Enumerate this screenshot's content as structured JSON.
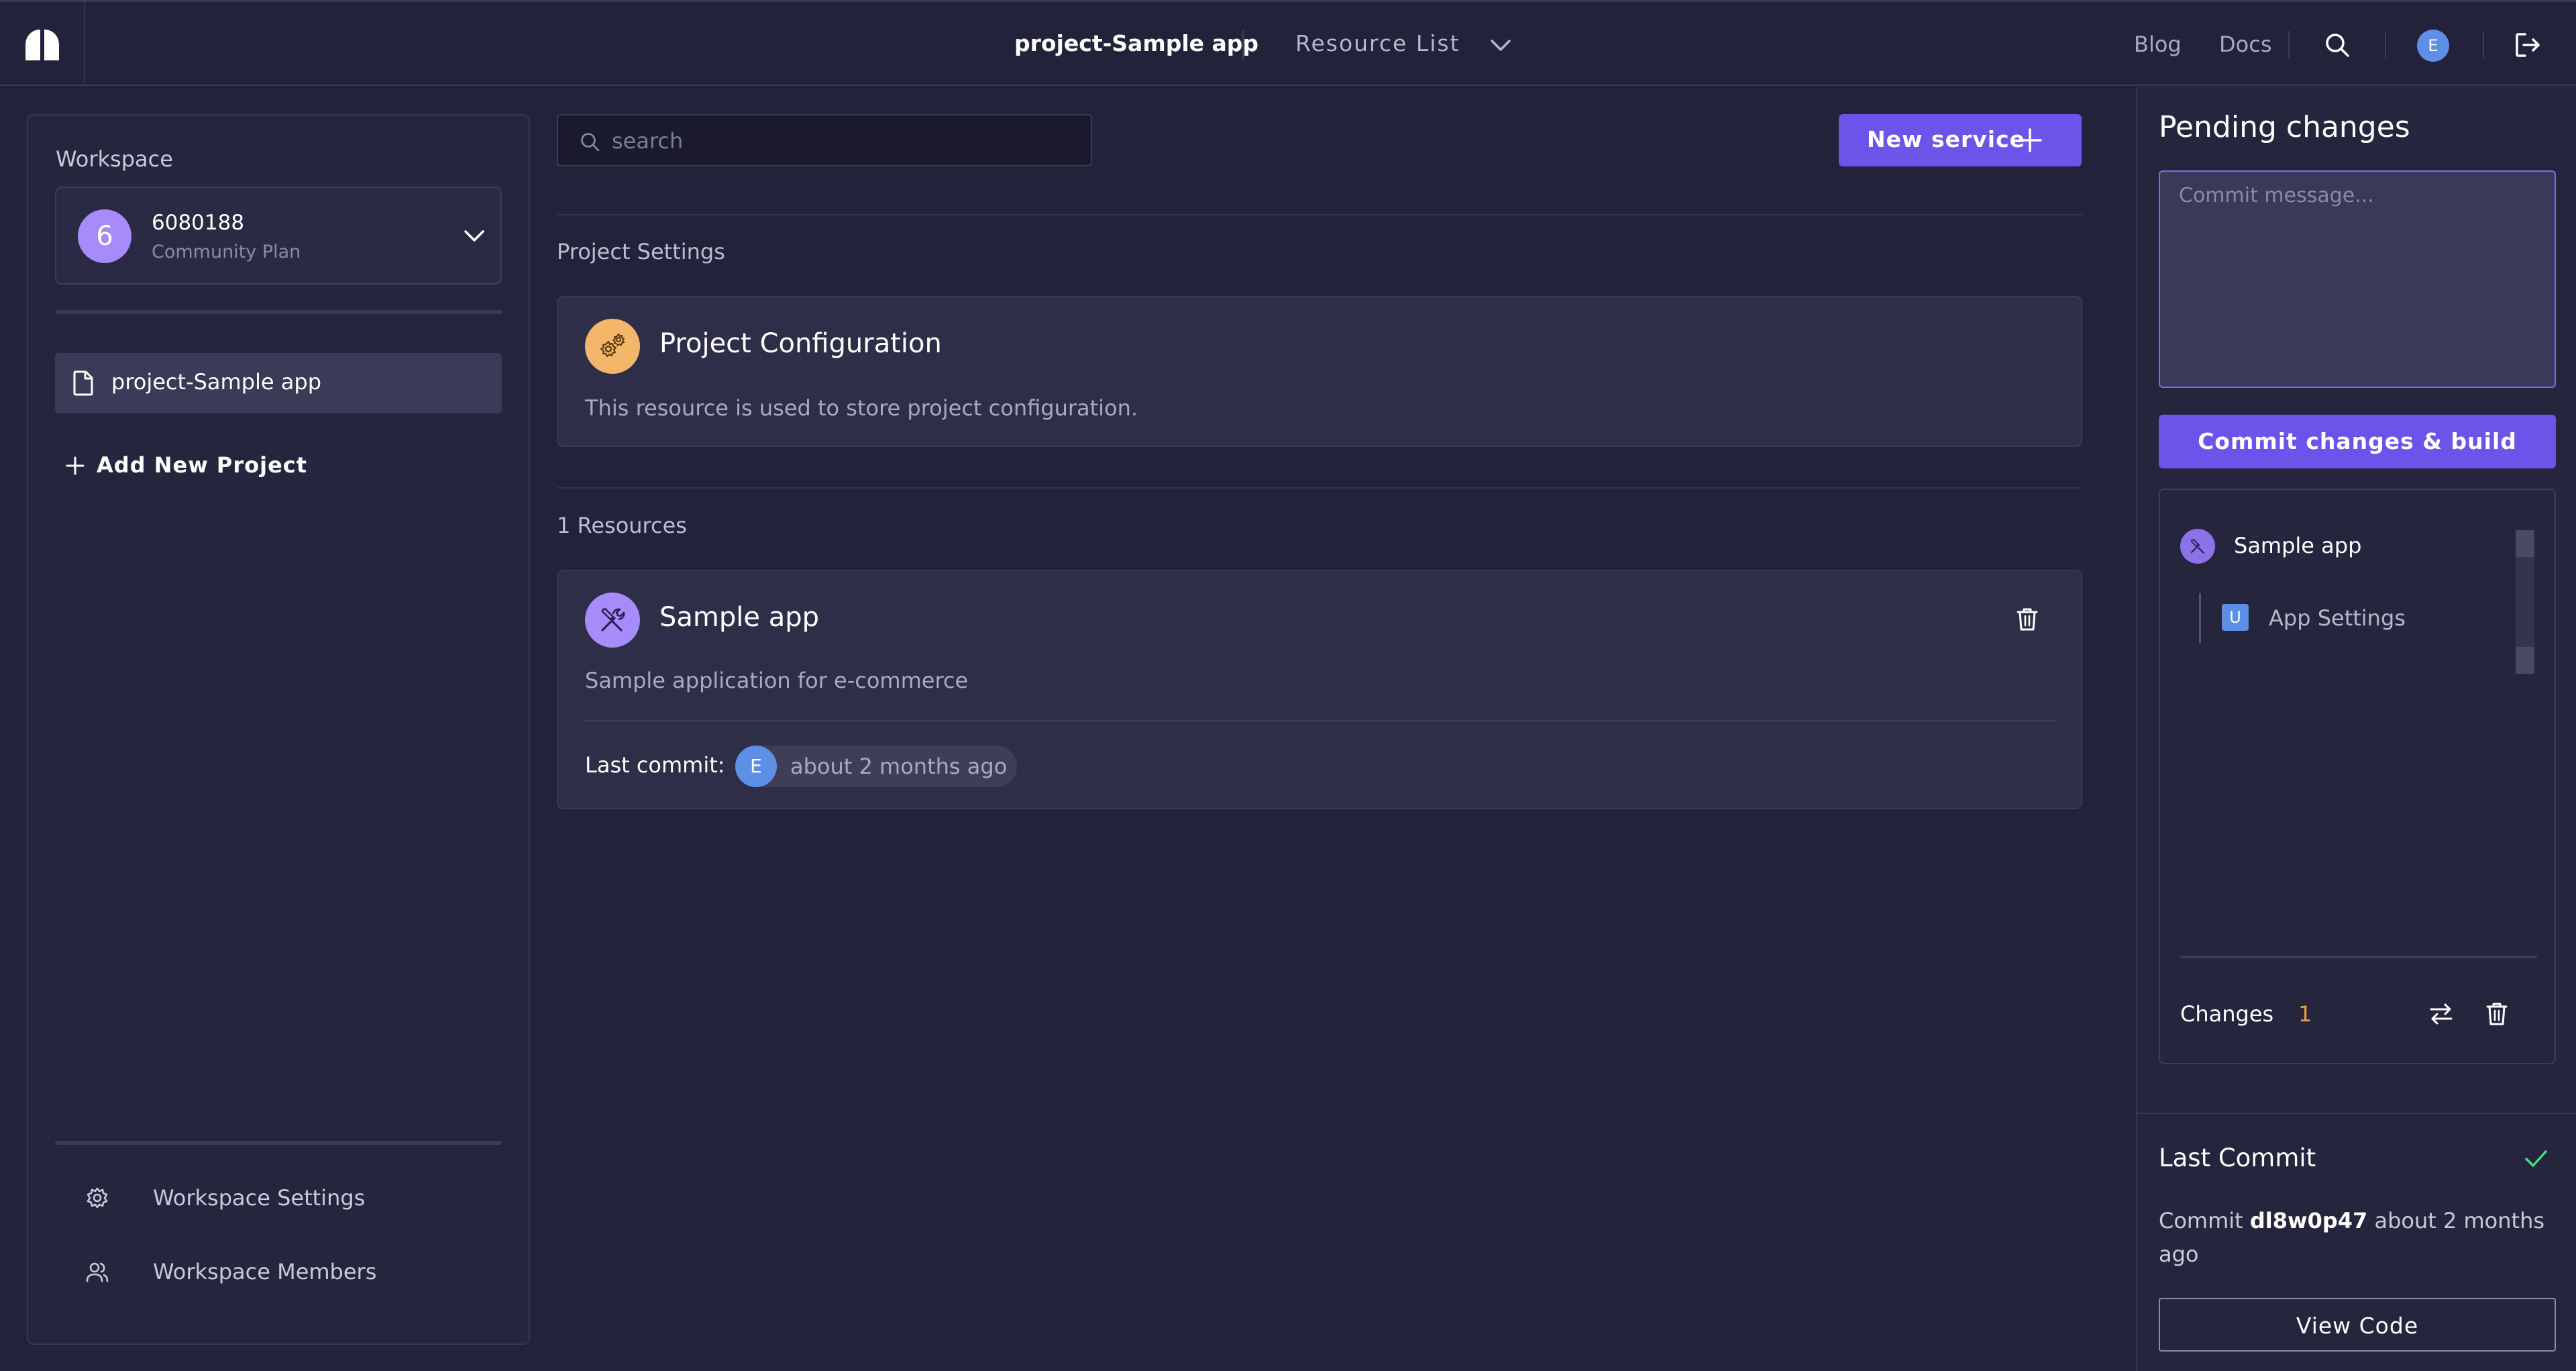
{
  "header": {
    "project_name": "project-Sample app",
    "view_selector": "Resource List",
    "links": {
      "blog": "Blog",
      "docs": "Docs"
    },
    "user_initial": "E"
  },
  "sidebar": {
    "workspace_label": "Workspace",
    "workspace": {
      "initial": "6",
      "name": "6080188",
      "plan": "Community Plan"
    },
    "projects": [
      {
        "label": "project-Sample app",
        "active": true
      }
    ],
    "add_project_label": "Add New Project",
    "footer_links": [
      {
        "label": "Workspace Settings",
        "icon": "gear-icon"
      },
      {
        "label": "Workspace Members",
        "icon": "users-icon"
      }
    ]
  },
  "main": {
    "search": {
      "placeholder": "search",
      "value": ""
    },
    "new_service_label": "New service",
    "project_settings": {
      "section_label": "Project Settings",
      "card": {
        "title": "Project Configuration",
        "description": "This resource is used to store project configuration.",
        "icon": "settings-gears-icon",
        "icon_color": "#f4b66a"
      }
    },
    "resources": {
      "section_label": "1 Resources",
      "items": [
        {
          "title": "Sample app",
          "description": "Sample application for e-commerce",
          "icon": "tools-icon",
          "icon_color": "#a78bfa",
          "last_commit_label": "Last commit:",
          "last_commit_user": "E",
          "last_commit_time": "about 2 months ago"
        }
      ]
    }
  },
  "right_panel": {
    "title": "Pending changes",
    "commit_placeholder": "Commit message...",
    "commit_button": "Commit changes & build",
    "tree": [
      {
        "label": "Sample app",
        "icon": "tools-icon"
      },
      {
        "label": "App Settings",
        "badge": "U"
      }
    ],
    "changes_label": "Changes",
    "changes_count": "1",
    "last_commit": {
      "title": "Last Commit",
      "prefix": "Commit",
      "hash": "dl8w0p47",
      "suffix": "about 2 months ago",
      "view_code_label": "View Code"
    }
  },
  "colors": {
    "accent": "#6d53e9",
    "background": "#22223a",
    "panel": "#25253d",
    "card": "#2e2e48",
    "changes_count": "#f0a13a",
    "success_check": "#4ade80"
  }
}
